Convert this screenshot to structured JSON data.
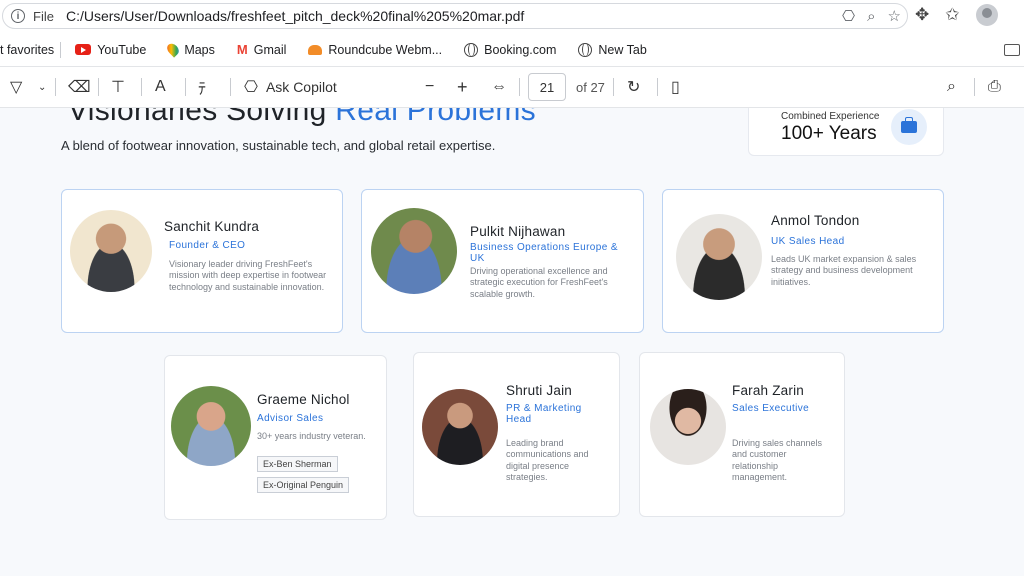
{
  "browser": {
    "info_symbol": "i",
    "file_label": "File",
    "url": "C:/Users/User/Downloads/freshfeet_pitch_deck%20final%205%20mar.pdf"
  },
  "bookmarks": {
    "favorites_label": "t favorites",
    "items": [
      "YouTube",
      "Maps",
      "Gmail",
      "Roundcube Webm...",
      "Booking.com",
      "New Tab"
    ],
    "gmail_glyph": "M"
  },
  "pdf_toolbar": {
    "ask_copilot": "Ask Copilot",
    "page_number": "21",
    "page_total": "of 27",
    "minus": "−",
    "plus": "+"
  },
  "slide": {
    "headline_part1": "Visionaries Solving ",
    "headline_part2": "Real Problems",
    "subheadline": "A blend of footwear innovation, sustainable tech, and global retail expertise.",
    "experience": {
      "label": "Combined Experience",
      "value": "100+ Years"
    },
    "team": [
      {
        "name": "Sanchit Kundra",
        "role": "Founder & CEO",
        "description": "Visionary leader driving FreshFeet's mission with deep expertise in footwear technology and sustainable innovation."
      },
      {
        "name": "Pulkit Nijhawan",
        "role": "Business Operations Europe & UK",
        "description": "Driving operational excellence and strategic execution for FreshFeet's scalable growth."
      },
      {
        "name": "Anmol Tondon",
        "role": "UK Sales Head",
        "description": "Leads UK market expansion & sales strategy and business development initiatives."
      },
      {
        "name": "Graeme Nichol",
        "role": "Advisor Sales",
        "description": "30+ years industry veteran.",
        "tags": [
          "Ex-Ben Sherman",
          "Ex-Original Penguin"
        ]
      },
      {
        "name": "Shruti Jain",
        "role": "PR & Marketing Head",
        "description": "Leading brand communications and digital presence strategies."
      },
      {
        "name": "Farah Zarin",
        "role": "Sales Executive",
        "description": "Driving sales channels and customer relationship management."
      }
    ]
  }
}
